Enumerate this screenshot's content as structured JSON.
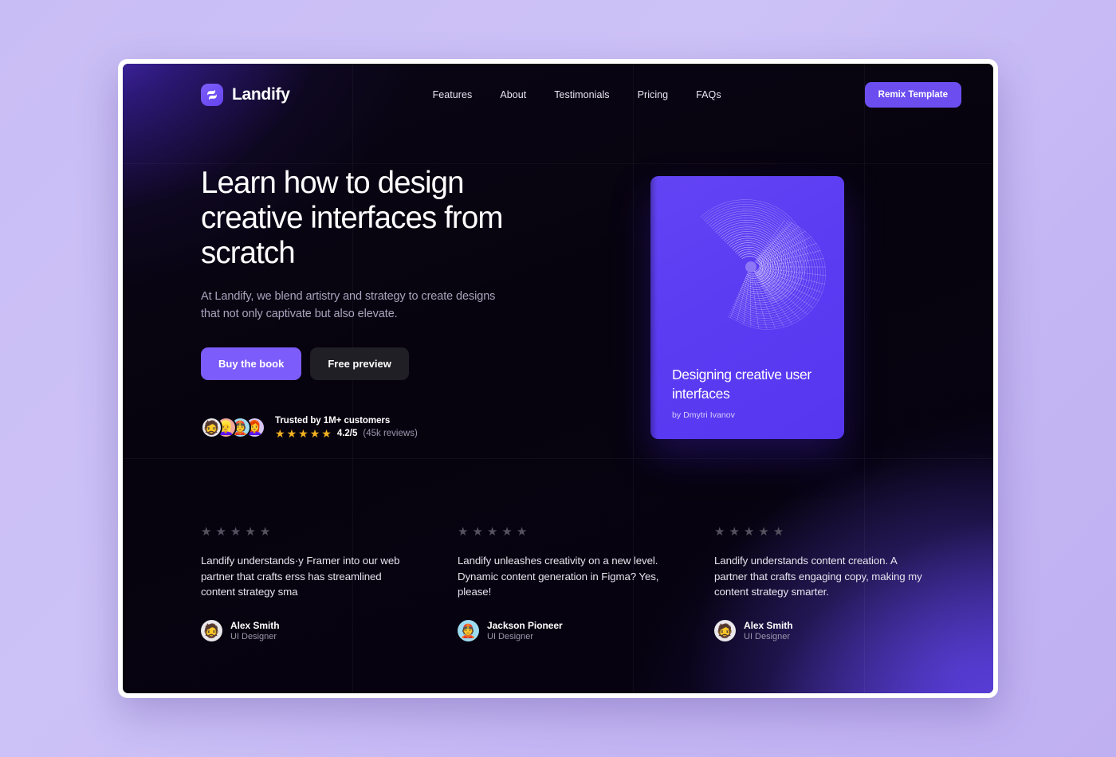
{
  "header": {
    "brand_name": "Landify",
    "logo_icon": "landify-logo-icon",
    "nav": [
      {
        "label": "Features"
      },
      {
        "label": "About"
      },
      {
        "label": "Testimonials"
      },
      {
        "label": "Pricing"
      },
      {
        "label": "FAQs"
      }
    ],
    "cta_label": "Remix Template",
    "cta_color": "#6c4ef0"
  },
  "hero": {
    "title": "Learn how to design creative interfaces from scratch",
    "subtitle": "At Landify, we blend artistry and strategy to create designs that not only captivate but also elevate.",
    "primary_button": "Buy the book",
    "secondary_button": "Free preview",
    "primary_button_color": "#7c5cfa",
    "secondary_button_color": "#211f26"
  },
  "trust": {
    "label": "Trusted by 1M+ customers",
    "stars": "★★★★★",
    "star_count": 5,
    "star_color": "#f5b321",
    "score": "4.2/5",
    "reviews": "(45k reviews)",
    "avatars": [
      {
        "face": "🧔",
        "bg": "#e9e7ea"
      },
      {
        "face": "👱‍♀️",
        "bg": "#f2a79b"
      },
      {
        "face": "👲",
        "bg": "#9ddbf0"
      },
      {
        "face": "👩‍🦰",
        "bg": "#d7c6f5"
      }
    ]
  },
  "book": {
    "title": "Designing creative user interfaces",
    "author": "by Dmytri Ivanov",
    "cover_color": "#5b3cf2",
    "art_name": "spiral-wireframe-art"
  },
  "testimonials": [
    {
      "stars": 5,
      "quote": "Landify understands·y Framer into our web partner that crafts erss has streamlined content strategy sma",
      "name": "Alex Smith",
      "role": "UI Designer",
      "avatar_face": "🧔",
      "avatar_bg": "#e9e7ea"
    },
    {
      "stars": 5,
      "quote": "Landify unleashes creativity on a new level. Dynamic content generation in Figma? Yes, please!",
      "name": "Jackson Pioneer",
      "role": "UI Designer",
      "avatar_face": "👲",
      "avatar_bg": "#9ddbf0"
    },
    {
      "stars": 5,
      "quote": "Landify understands content creation. A partner that crafts engaging copy, making my content strategy smarter.",
      "name": "Alex Smith",
      "role": "UI Designer",
      "avatar_face": "🧔",
      "avatar_bg": "#e9e7ea"
    }
  ],
  "side_panel": {
    "items": [
      {
        "icon": "windows-copy-icon"
      },
      {
        "icon": "shopping-cart-icon"
      }
    ]
  }
}
